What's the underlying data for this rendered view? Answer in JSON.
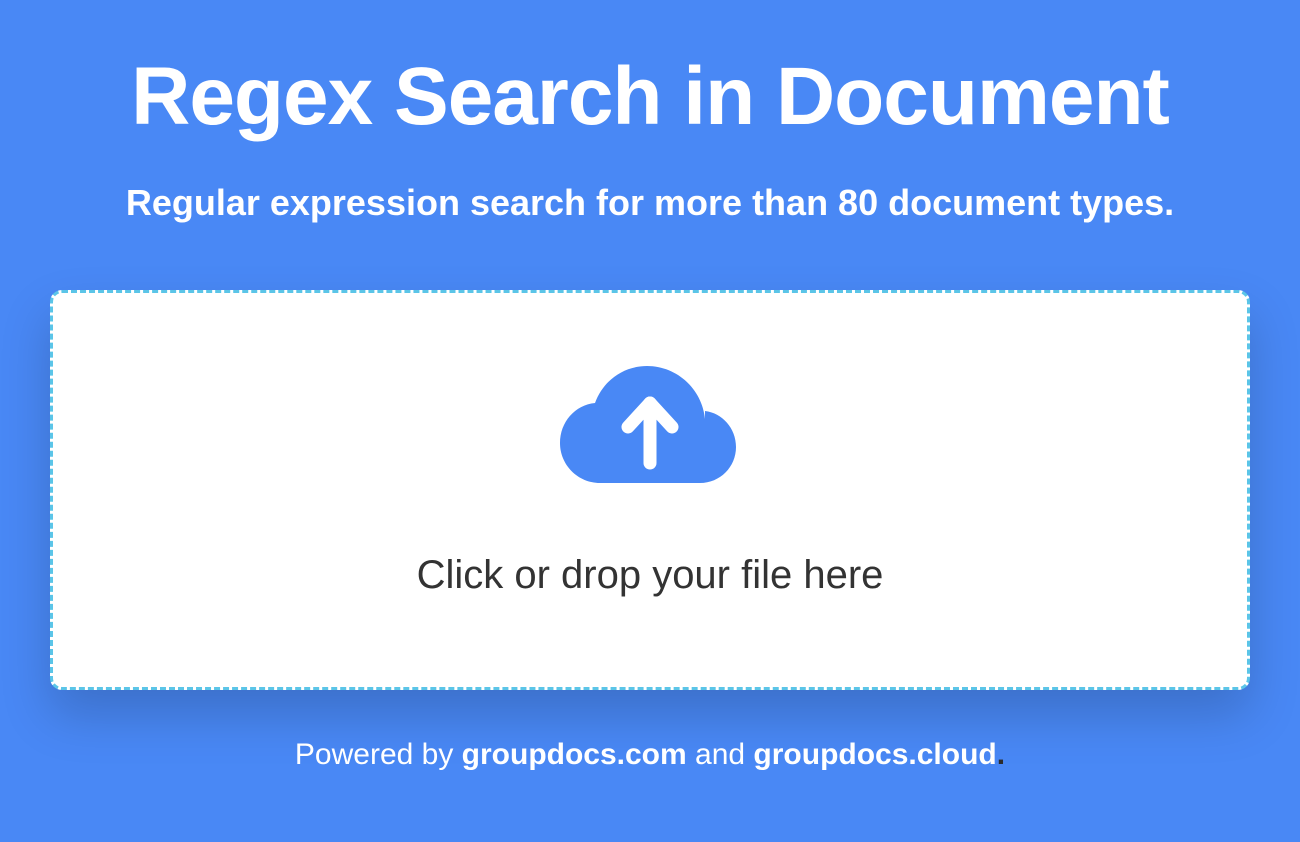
{
  "header": {
    "title": "Regex Search in Document",
    "subtitle": "Regular expression search for more than 80 document types."
  },
  "dropzone": {
    "instruction": "Click or drop your file here"
  },
  "footer": {
    "prefix": "Powered by ",
    "link1": "groupdocs.com",
    "conjunction": " and ",
    "link2": "groupdocs.cloud",
    "suffix": "."
  }
}
